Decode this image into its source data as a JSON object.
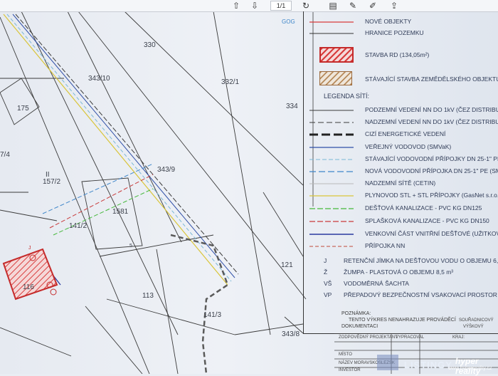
{
  "toolbar": {
    "buttons": [
      {
        "name": "page-up-button",
        "glyph": "⇧"
      },
      {
        "name": "page-down-button",
        "glyph": "⇩"
      },
      {
        "name": "rotate-button",
        "glyph": "↻"
      },
      {
        "name": "comment-button",
        "glyph": "▤"
      },
      {
        "name": "pen-button",
        "glyph": "✎"
      },
      {
        "name": "highlighter-button",
        "glyph": "✐"
      },
      {
        "name": "share-button",
        "glyph": "⇪"
      }
    ],
    "page_current": "1",
    "page_total": "/1"
  },
  "map": {
    "parcels": [
      "330",
      "343/10",
      "332/1",
      "334",
      "175",
      "7/4",
      "157/2",
      "343/9",
      "1581",
      "141/2",
      "121",
      "113",
      "141/3",
      "343/8",
      "116",
      "II"
    ],
    "labels": [
      "GOG",
      "5",
      "J"
    ]
  },
  "legend": {
    "rows": [
      {
        "code": "",
        "text": "NOVÉ OBJEKTY"
      },
      {
        "code": "",
        "text": "HRANICE POZEMKU"
      },
      {
        "code": "",
        "text": "STAVBA RD (134,05m²)"
      },
      {
        "code": "",
        "text": "STÁVAJÍCÍ STAVBA ZEMĚDĚLSKÉHO OBJEKTU"
      },
      {
        "code": "",
        "text": "LEGENDA SÍTÍ:"
      },
      {
        "code": "",
        "text": "PODZEMNÍ VEDENÍ NN DO 1kV (ČEZ DISTRIBU"
      },
      {
        "code": "",
        "text": "NADZEMNÍ VEDENÍ NN DO 1kV (ČEZ DISTRIBU"
      },
      {
        "code": "",
        "text": "CIZÍ ENERGETICKÉ VEDENÍ"
      },
      {
        "code": "",
        "text": "VEŘEJNÝ VODOVOD (SMVaK)"
      },
      {
        "code": "",
        "text": "STÁVAJÍCÍ VODOVODNÍ PŘÍPOJKY DN 25-1\" PE"
      },
      {
        "code": "",
        "text": "NOVÁ VODOVODNÍ PŘÍPOJKA DN 25-1\" PE (SM"
      },
      {
        "code": "",
        "text": "NADZEMNÍ SÍTĚ (CETIN)"
      },
      {
        "code": "",
        "text": "PLYNOVOD STL + STL PŘÍPOJKY (GasNet s.r.o."
      },
      {
        "code": "",
        "text": "DEŠŤOVÁ KANALIZACE - PVC KG DN125"
      },
      {
        "code": "",
        "text": "SPLAŠKOVÁ KANALIZACE - PVC KG DN150"
      },
      {
        "code": "",
        "text": "VENKOVNÍ ČÁST VNITŘNÍ DEŠŤOVÉ (UŽITKOVÉ) V"
      },
      {
        "code": "",
        "text": "PŘÍPOJKA NN"
      },
      {
        "code": "J",
        "text": "RETENČNÍ JÍMKA NA DEŠŤOVOU VODU O OBJEMU 6,5 m"
      },
      {
        "code": "Ž",
        "text": "ŽUMPA - PLASTOVÁ O OBJEMU 8,5 m³"
      },
      {
        "code": "VŠ",
        "text": "VODOMĚRNÁ ŠACHTA"
      },
      {
        "code": "VP",
        "text": "PŘEPADOVÝ BEZPEČNOSTNÍ VSAKOVACÍ PROSTOR 15m²"
      }
    ],
    "colors": {
      "new_objects": "#d83b3b",
      "boundary": "#333333",
      "underground_nn": "#3a3a3a",
      "overhead_nn": "#3a3a3a",
      "foreign_power": "#222222",
      "public_water": "#2f4fa8",
      "existing_water": "#7ab7d6",
      "new_water": "#3f86c9",
      "cetin": "#b9b9b9",
      "gas": "#d9c53a",
      "storm_sewer": "#44b83a",
      "sewage": "#c93b3b",
      "rain_outdoor": "#2a3aa0",
      "connection_nn": "#c04a3a"
    }
  },
  "notes": {
    "heading": "POZNÁMKA:",
    "line1": "TENTO VÝKRES NENAHRAZUJE PROVÁDĚCÍ",
    "line2": "DOKUMENTACI"
  },
  "title_block": {
    "coordinates": "SOUŘADNICOVÝ",
    "coord_sub": "VÝŠKOVÝ",
    "designer": "ZODPOVĚDNÝ PROJEKTANT",
    "prepared": "VYPRACOVAL",
    "region": "KRAJ:",
    "location": "MÍSTO",
    "investor": "INVESTOR",
    "builder": "NÁZEV MORAVSKOSLEZSK"
  },
  "watermark": {
    "brand": "LISTINGY",
    "brand2": "hyper reality",
    "url": "www.hyperreality.cz"
  }
}
